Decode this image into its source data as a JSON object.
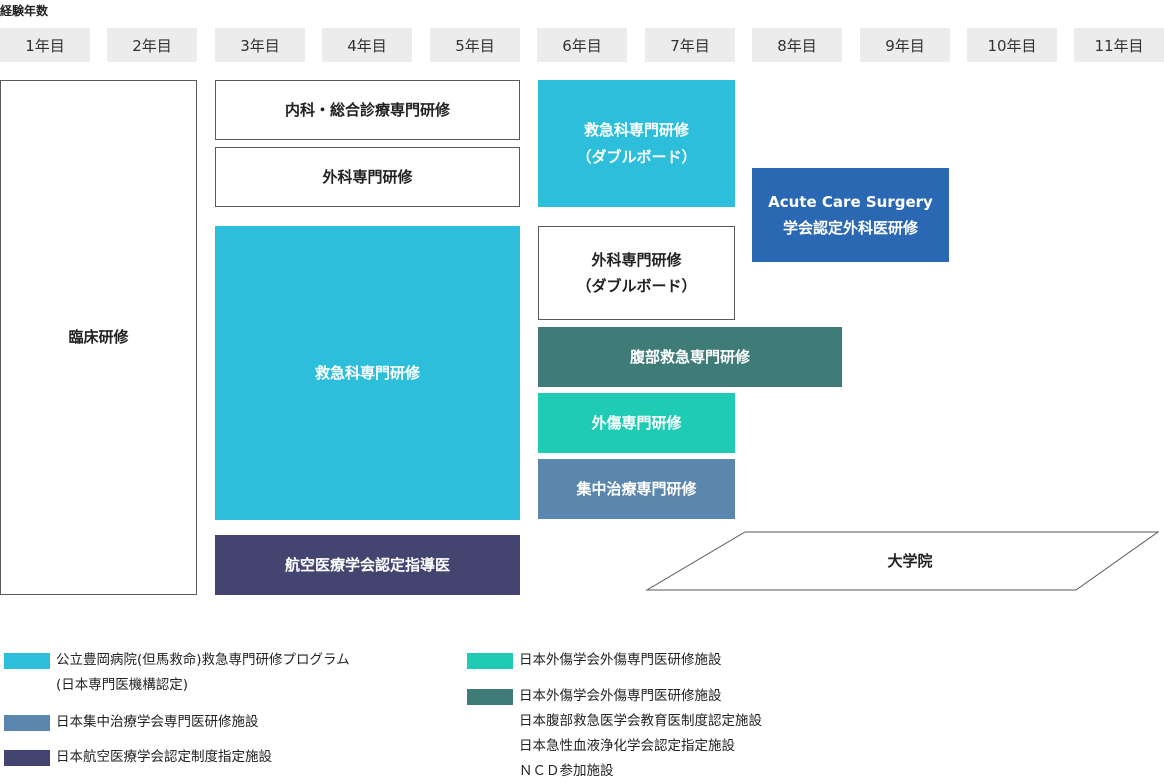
{
  "header_label": "経験年数",
  "years": [
    "1年目",
    "2年目",
    "3年目",
    "4年目",
    "5年目",
    "6年目",
    "7年目",
    "8年目",
    "9年目",
    "10年目",
    "11年目"
  ],
  "blocks": {
    "rinsho": "臨床研修",
    "naika": "内科・総合診療専門研修",
    "geka": "外科専門研修",
    "kyukyu_main": "救急科専門研修",
    "koku": "航空医療学会認定指導医",
    "kyukyu_db": "救急科専門研修\n（ダブルボード）",
    "geka_db": "外科専門研修\n（ダブルボード）",
    "acs": "Acute Care Surgery\n学会認定外科医研修",
    "fukubu": "腹部救急専門研修",
    "gaisho": "外傷専門研修",
    "shuchu": "集中治療専門研修",
    "daigakuin": "大学院"
  },
  "legend": [
    {
      "color": "#2dbedb",
      "text": "公立豊岡病院(但馬救命)救急専門研修プログラム\n(日本専門医機構認定)"
    },
    {
      "color": "#5b86ad",
      "text": "日本集中治療学会専門医研修施設"
    },
    {
      "color": "#444471",
      "text": "日本航空医療学会認定制度指定施設"
    },
    {
      "color": "#20cbb3",
      "text": "日本外傷学会外傷専門医研修施設"
    },
    {
      "color": "#3f7c77",
      "text": "日本外傷学会外傷専門医研修施設\n日本腹部救急医学会教育医制度認定施設\n日本急性血液浄化学会認定指定施設\nＮＣＤ参加施設"
    }
  ],
  "colors": {
    "cyan": "#2dbedb",
    "steel": "#5b86ad",
    "navy": "#444471",
    "teal": "#20cbb3",
    "darkteal": "#3f7c77",
    "blue": "#2b68b3"
  }
}
